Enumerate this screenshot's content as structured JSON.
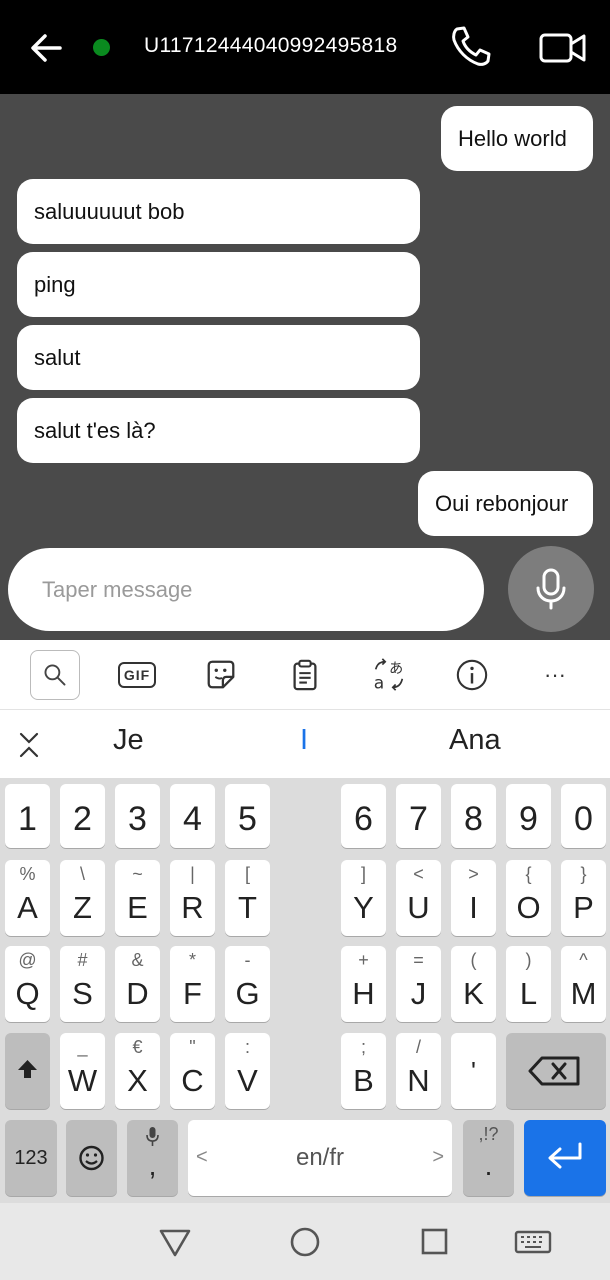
{
  "header": {
    "user_id": "U11712444040992495818",
    "status_color": "#0a8a1f"
  },
  "messages": [
    {
      "side": "sent",
      "text": "Hello world"
    },
    {
      "side": "received",
      "text": "saluuuuuut bob"
    },
    {
      "side": "received",
      "text": "ping"
    },
    {
      "side": "received",
      "text": "salut"
    },
    {
      "side": "received",
      "text": "salut t'es là?"
    },
    {
      "side": "sent",
      "text": "Oui rebonjour"
    }
  ],
  "composer": {
    "placeholder": "Taper message"
  },
  "keyboard_toolbar": {
    "tools": [
      "search-icon",
      "gif-icon",
      "sticker-icon",
      "clipboard-icon",
      "translate-icon",
      "info-icon",
      "more-icon"
    ],
    "gif_label": "GIF",
    "more_label": "···"
  },
  "suggestions": {
    "left": "Je",
    "middle": "I",
    "right": "Ana"
  },
  "keyboard": {
    "number_row": [
      "1",
      "2",
      "3",
      "4",
      "5",
      "6",
      "7",
      "8",
      "9",
      "0"
    ],
    "row1": [
      {
        "main": "A",
        "sec": "%"
      },
      {
        "main": "Z",
        "sec": "\\"
      },
      {
        "main": "E",
        "sec": "~"
      },
      {
        "main": "R",
        "sec": "|"
      },
      {
        "main": "T",
        "sec": "["
      },
      {
        "main": "Y",
        "sec": "]"
      },
      {
        "main": "U",
        "sec": "<"
      },
      {
        "main": "I",
        "sec": ">"
      },
      {
        "main": "O",
        "sec": "{"
      },
      {
        "main": "P",
        "sec": "}"
      }
    ],
    "row2": [
      {
        "main": "Q",
        "sec": "@"
      },
      {
        "main": "S",
        "sec": "#"
      },
      {
        "main": "D",
        "sec": "&"
      },
      {
        "main": "F",
        "sec": "*"
      },
      {
        "main": "G",
        "sec": "-"
      },
      {
        "main": "H",
        "sec": "+"
      },
      {
        "main": "J",
        "sec": "="
      },
      {
        "main": "K",
        "sec": "("
      },
      {
        "main": "L",
        "sec": ")"
      },
      {
        "main": "M",
        "sec": "^"
      }
    ],
    "row3": [
      {
        "main": "W",
        "sec": "_"
      },
      {
        "main": "X",
        "sec": "€"
      },
      {
        "main": "C",
        "sec": "\""
      },
      {
        "main": "V",
        "sec": ":"
      },
      {
        "main": "B",
        "sec": ";"
      },
      {
        "main": "N",
        "sec": "/"
      },
      {
        "main": "'",
        "sec": ""
      }
    ],
    "bottom": {
      "numbers": "123",
      "comma": ",",
      "space": "en/fr",
      "space_left": "<",
      "space_right": ">",
      "period_sec": ",!?",
      "period": "."
    },
    "enter_color": "#1a73e8"
  },
  "navbar": {
    "buttons": [
      "back-triangle-icon",
      "home-circle-icon",
      "recents-square-icon",
      "keyboard-icon"
    ]
  }
}
